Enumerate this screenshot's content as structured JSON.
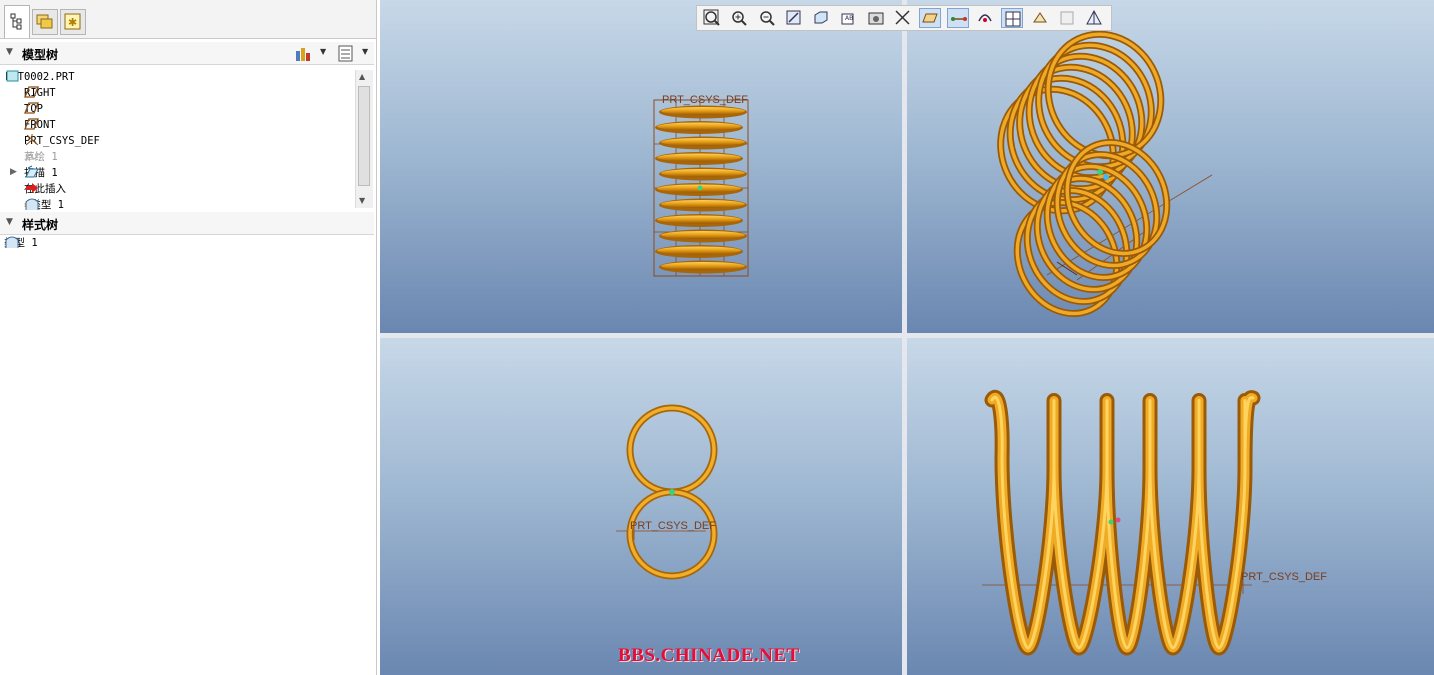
{
  "model_tree": {
    "title": "模型树",
    "items": [
      {
        "label": "PRT0002.PRT"
      },
      {
        "label": "RIGHT"
      },
      {
        "label": "TOP"
      },
      {
        "label": "FRONT"
      },
      {
        "label": "PRT_CSYS_DEF"
      },
      {
        "label": "草绘 1"
      },
      {
        "label": "扫描 1"
      },
      {
        "label": "在此插入"
      },
      {
        "label": "类型 1"
      }
    ]
  },
  "style_tree": {
    "title": "样式树",
    "items": [
      {
        "label": "类型 1"
      }
    ]
  },
  "viewports": {
    "csys_label": "PRT_CSYS_DEF"
  },
  "toolbar": {
    "buttons": [
      "zoom-fit",
      "zoom-in",
      "zoom-out",
      "repaint",
      "display-style",
      "saved-views",
      "view-manager",
      "datum-display",
      "plane-display",
      "axis-display",
      "point-display",
      "csys-display",
      "spin-center",
      "annotation-display",
      "style-view"
    ]
  },
  "colors": {
    "spring": "#e39a12",
    "spring_dark": "#a8660a",
    "viewport_top": "#c7d8e8",
    "viewport_bottom": "#6a87b1",
    "watermark": "#e0103a"
  },
  "watermark": "BBS.CHINADE.NET"
}
